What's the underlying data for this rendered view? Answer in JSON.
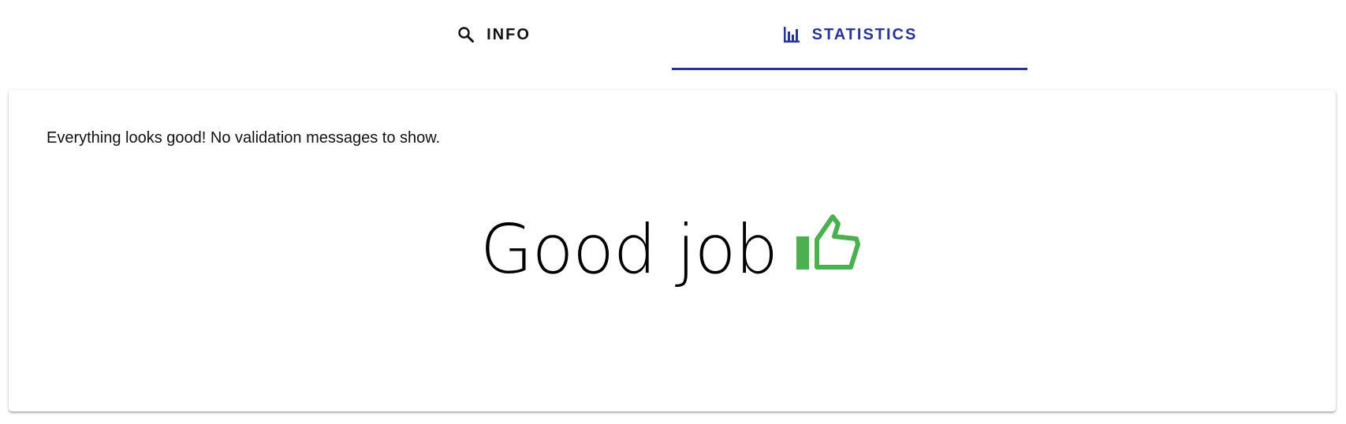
{
  "tabs": [
    {
      "label": "INFO",
      "icon": "search-icon",
      "selected": false
    },
    {
      "label": "STATISTICS",
      "icon": "bar-chart-icon",
      "selected": true
    }
  ],
  "colors": {
    "accent": "#283593",
    "success": "#4caf50",
    "text": "#111111"
  },
  "panel": {
    "message": "Everything looks good! No validation messages to show.",
    "headline": "Good job",
    "headline_icon": "thumbs-up-icon"
  }
}
